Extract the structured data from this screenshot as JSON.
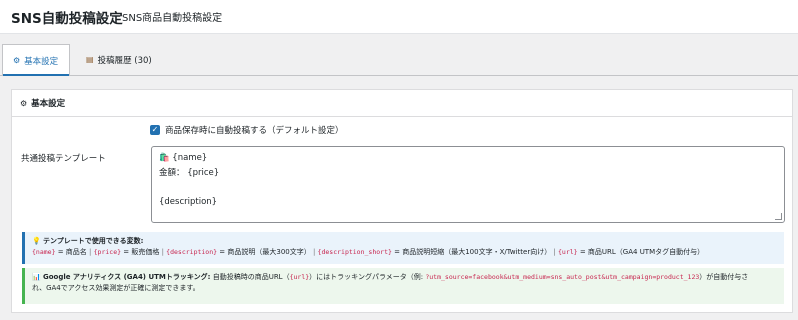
{
  "header": {
    "title": "SNS自動投稿設定",
    "subtitle": "SNS商品自動投稿設定"
  },
  "tabs": [
    {
      "icon": "gear-icon",
      "glyph": "⚙",
      "label": "基本設定",
      "active": true
    },
    {
      "icon": "book-icon",
      "glyph": "▤",
      "label": "投稿履歴 (30)",
      "active": false
    }
  ],
  "card": {
    "icon": "gear-icon",
    "glyph": "⚙",
    "title": "基本設定",
    "auto_post": {
      "checked": true,
      "label": "商品保存時に自動投稿する（デフォルト設定）"
    },
    "template_label": "共通投稿テンプレート",
    "template_lines": [
      "🛍️ {name}",
      "金額： {price}",
      "",
      "{description}",
      "",
      "#"
    ],
    "help": {
      "icon": "lightbulb-icon",
      "glyph": "💡",
      "title": "テンプレートで使用できる変数:",
      "vars": [
        {
          "code": "{name}",
          "desc": " = 商品名"
        },
        {
          "code": "{price}",
          "desc": " = 販売価格"
        },
        {
          "code": "{description}",
          "desc": " = 商品説明（最大300文字）"
        },
        {
          "code": "{description_short}",
          "desc": " = 商品説明短縮（最大100文字・X/Twitter向け）"
        },
        {
          "code": "{url}",
          "desc": " = 商品URL（GA4 UTMタグ自動付与）"
        }
      ],
      "separator": " | "
    },
    "utm": {
      "icon": "bar-chart-icon",
      "glyph": "📊",
      "title": "Google アナリティクス (GA4) UTMトラッキング:",
      "text1": " 自動投稿時の商品URL（",
      "code1": "{url}",
      "text2": "）にはトラッキングパラメータ（例: ",
      "code2": "?utm_source=facebook&utm_medium=sns_auto_post&utm_campaign=product_123",
      "text3": "）が自動付与さ",
      "line2": "れ、GA4でアクセス効果測定が正確に測定できます。"
    }
  }
}
